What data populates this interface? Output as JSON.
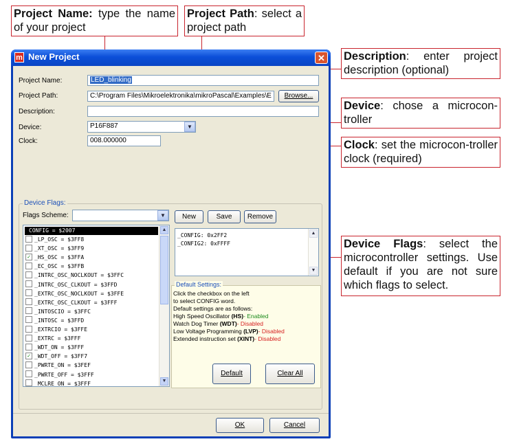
{
  "annotations": {
    "project_name": {
      "title": "Project Name:",
      "text": " type the name of your project"
    },
    "project_path": {
      "title": "Project Path",
      "text": ": select a project path"
    },
    "description": {
      "title": "Description",
      "text": ": enter project description (optional)"
    },
    "device": {
      "title": "Device",
      "text": ": chose a microcon-troller"
    },
    "clock": {
      "title": "Clock",
      "text": ": set the microcon-troller clock (required)"
    },
    "device_flags": {
      "title": "Device Flags",
      "text": ": select the microcontroller settings. Use default if you are not sure which flags to select."
    }
  },
  "window": {
    "title": "New Project",
    "close_glyph": "✕",
    "icon_letter": "m"
  },
  "form": {
    "project_name_label": "Project Name:",
    "project_name_value": "LED_blinking",
    "project_path_label": "Project Path:",
    "project_path_value": "C:\\Program Files\\Mikroelektronika\\mikroPascal\\Examples\\E",
    "browse_label": "Browse...",
    "description_label": "Description:",
    "description_value": "",
    "device_label": "Device:",
    "device_value": "P16F887",
    "clock_label": "Clock:",
    "clock_value": "008.000000"
  },
  "device_flags": {
    "group_title": "Device Flags:",
    "scheme_label": "Flags Scheme:",
    "scheme_value": "",
    "new_label": "New",
    "save_label": "Save",
    "remove_label": "Remove",
    "header": "CONFIG = $2007",
    "flags": [
      {
        "name": "_LP_OSC = $3FF8",
        "checked": false
      },
      {
        "name": "_XT_OSC = $3FF9",
        "checked": false
      },
      {
        "name": "_HS_OSC = $3FFA",
        "checked": true
      },
      {
        "name": "_EC_OSC = $3FFB",
        "checked": false
      },
      {
        "name": "_INTRC_OSC_NOCLKOUT = $3FFC",
        "checked": false
      },
      {
        "name": "_INTRC_OSC_CLKOUT = $3FFD",
        "checked": false
      },
      {
        "name": "_EXTRC_OSC_NOCLKOUT = $3FFE",
        "checked": false
      },
      {
        "name": "_EXTRC_OSC_CLKOUT = $3FFF",
        "checked": false
      },
      {
        "name": "_INTOSCIO = $3FFC",
        "checked": false
      },
      {
        "name": "_INTOSC = $3FFD",
        "checked": false
      },
      {
        "name": "_EXTRCIO = $3FFE",
        "checked": false
      },
      {
        "name": "_EXTRC = $3FFF",
        "checked": false
      },
      {
        "name": "_WDT_ON = $3FFF",
        "checked": false
      },
      {
        "name": "_WDT_OFF = $3FF7",
        "checked": true
      },
      {
        "name": "_PWRTE_ON = $3FEF",
        "checked": false
      },
      {
        "name": "_PWRTE_OFF = $3FFF",
        "checked": false
      },
      {
        "name": "_MCLRE_ON = $3FFF",
        "checked": false
      }
    ],
    "config_lines": [
      "_CONFIG: 0x2FF2",
      "_CONFIG2: 0xFFFF"
    ],
    "default_settings": {
      "title": "Default Settings:",
      "lines": [
        {
          "text": "Click the checkbox on the left"
        },
        {
          "text": "to select CONFIG word."
        },
        {
          "text": "Default settings are as follows:"
        },
        {
          "pre": "High Speed Oscillator ",
          "key": "(HS)",
          "status": "- Enabled"
        },
        {
          "pre": "Watch Dog Timer ",
          "key": "(WDT)",
          "status": "- Disabled"
        },
        {
          "pre": "Low Voltage Programming ",
          "key": "(LVP)",
          "status": "- Disabled"
        },
        {
          "pre": "Extended instruction set ",
          "key": "(XINT)",
          "status": "- Disabled"
        }
      ],
      "default_label": "Default",
      "clear_all_label": "Clear All"
    }
  },
  "footer": {
    "ok_label": "OK",
    "cancel_label": "Cancel"
  },
  "colors": {
    "annotation_border": "#c8232c",
    "title_bar": "#0b4fd8",
    "enabled": "#1a8a1a",
    "disabled": "#d62020"
  }
}
